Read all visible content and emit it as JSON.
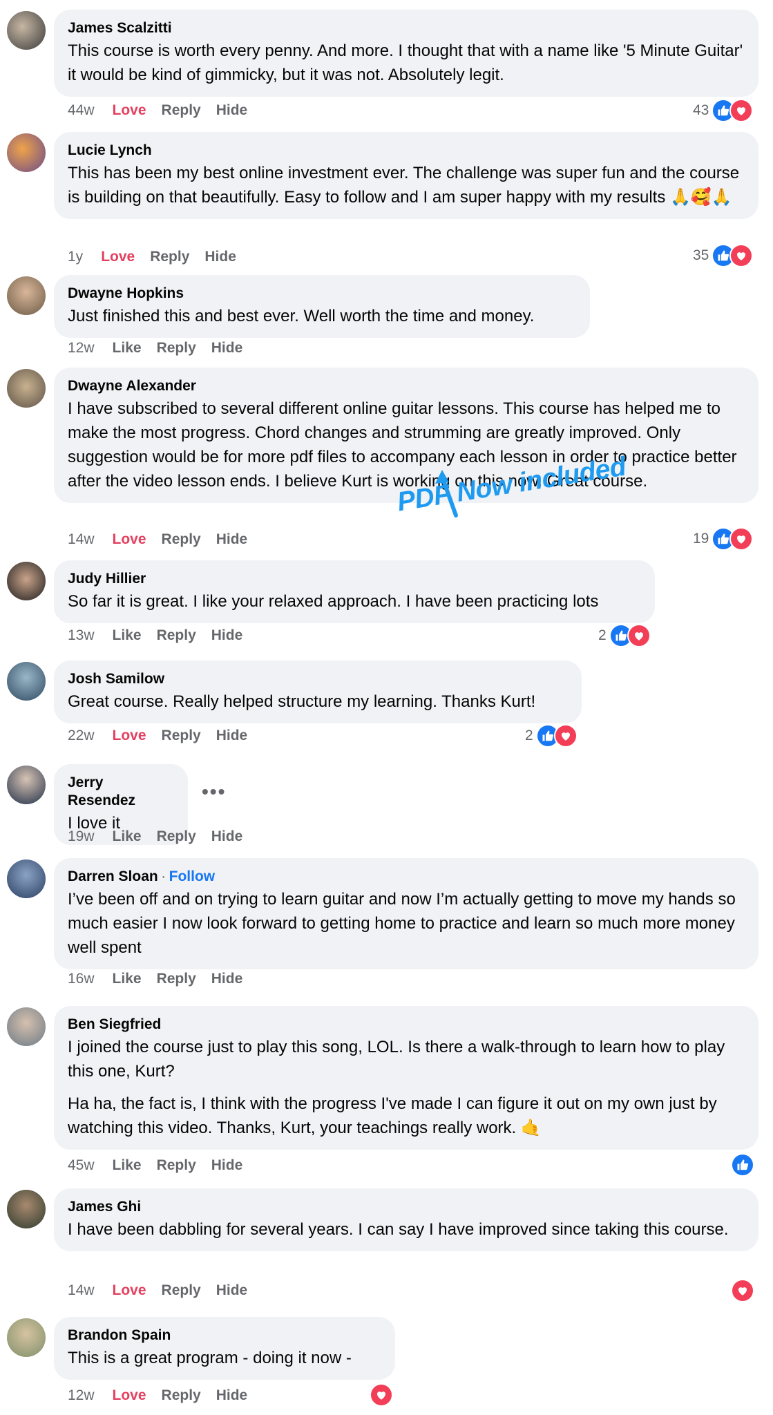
{
  "comments": [
    {
      "name": "James Scalzitti",
      "lines": [
        "This course is worth every penny. And more. I thought that with a name like '5 Minute Guitar' it would be kind of gimmicky, but it was not. Absolutely legit."
      ],
      "time": "44w",
      "react_label": "Love",
      "reply": "Reply",
      "hide": "Hide",
      "count": "43",
      "reactions": [
        "like",
        "love"
      ]
    },
    {
      "name": "Lucie Lynch",
      "lines": [
        "This has been my best online investment ever. The challenge was super fun and the course is building on that beautifully. Easy to follow and I am super happy with my results 🙏🥰🙏"
      ],
      "time": "1y",
      "react_label": "Love",
      "reply": "Reply",
      "hide": "Hide",
      "count": "35",
      "reactions": [
        "like",
        "love"
      ]
    },
    {
      "name": "Dwayne Hopkins",
      "lines": [
        "Just finished this and best ever. Well worth the time and money."
      ],
      "time": "12w",
      "react_label": "Like",
      "reply": "Reply",
      "hide": "Hide",
      "count": "",
      "reactions": []
    },
    {
      "name": "Dwayne Alexander",
      "lines": [
        "I have subscribed to several different online guitar lessons. This course has helped me to make the most progress. Chord changes and strumming are greatly improved. Only suggestion would be for more pdf files to accompany each lesson in order to practice better after the video lesson ends. I believe Kurt is working on this now. Great course."
      ],
      "time": "14w",
      "react_label": "Love",
      "reply": "Reply",
      "hide": "Hide",
      "count": "19",
      "reactions": [
        "like",
        "love"
      ]
    },
    {
      "name": "Judy Hillier",
      "lines": [
        "So far it is great. I like your relaxed approach. I have been practicing lots"
      ],
      "time": "13w",
      "react_label": "Like",
      "reply": "Reply",
      "hide": "Hide",
      "count": "2",
      "reactions": [
        "like",
        "love"
      ]
    },
    {
      "name": "Josh Samilow",
      "lines": [
        "Great course. Really helped structure my learning. Thanks Kurt!"
      ],
      "time": "22w",
      "react_label": "Love",
      "reply": "Reply",
      "hide": "Hide",
      "count": "2",
      "reactions": [
        "like",
        "love"
      ]
    },
    {
      "name": "Jerry Resendez",
      "lines": [
        "I love it"
      ],
      "time": "19w",
      "react_label": "Like",
      "reply": "Reply",
      "hide": "Hide",
      "count": "",
      "reactions": []
    },
    {
      "name": "Darren Sloan",
      "follow": "Follow",
      "lines": [
        "I’ve been off and on trying to learn guitar and now I’m actually getting to move my hands so much easier I now look forward to getting home to practice and learn so much more money well spent"
      ],
      "time": "16w",
      "react_label": "Like",
      "reply": "Reply",
      "hide": "Hide",
      "count": "",
      "reactions": []
    },
    {
      "name": "Ben Siegfried",
      "lines": [
        "I joined the course just to play this song, LOL. Is there a walk-through to learn how to play this one, Kurt?",
        "Ha ha, the fact is, I think with the progress I've made I can figure it out on my own just by watching this video. Thanks, Kurt, your teachings really work. 🤙"
      ],
      "time": "45w",
      "react_label": "Like",
      "reply": "Reply",
      "hide": "Hide",
      "count": "",
      "reactions": [
        "like"
      ]
    },
    {
      "name": "James Ghi",
      "lines": [
        "I have been dabbling for several years. I can say I have improved since taking this course."
      ],
      "time": "14w",
      "react_label": "Love",
      "reply": "Reply",
      "hide": "Hide",
      "count": "",
      "reactions": [
        "love"
      ]
    },
    {
      "name": "Brandon Spain",
      "lines": [
        "This is a great program - doing it now -"
      ],
      "time": "12w",
      "react_label": "Love",
      "reply": "Reply",
      "hide": "Hide",
      "count": "",
      "reactions": [
        "love"
      ]
    }
  ],
  "annotation": "PDF Now included",
  "more_options": "•••",
  "follow_separator": "·",
  "colors": {
    "bubble": "#f0f2f5",
    "love": "#e4405f",
    "link": "#1877f2",
    "annotation": "#1e9bf0",
    "meta": "#65676b"
  }
}
